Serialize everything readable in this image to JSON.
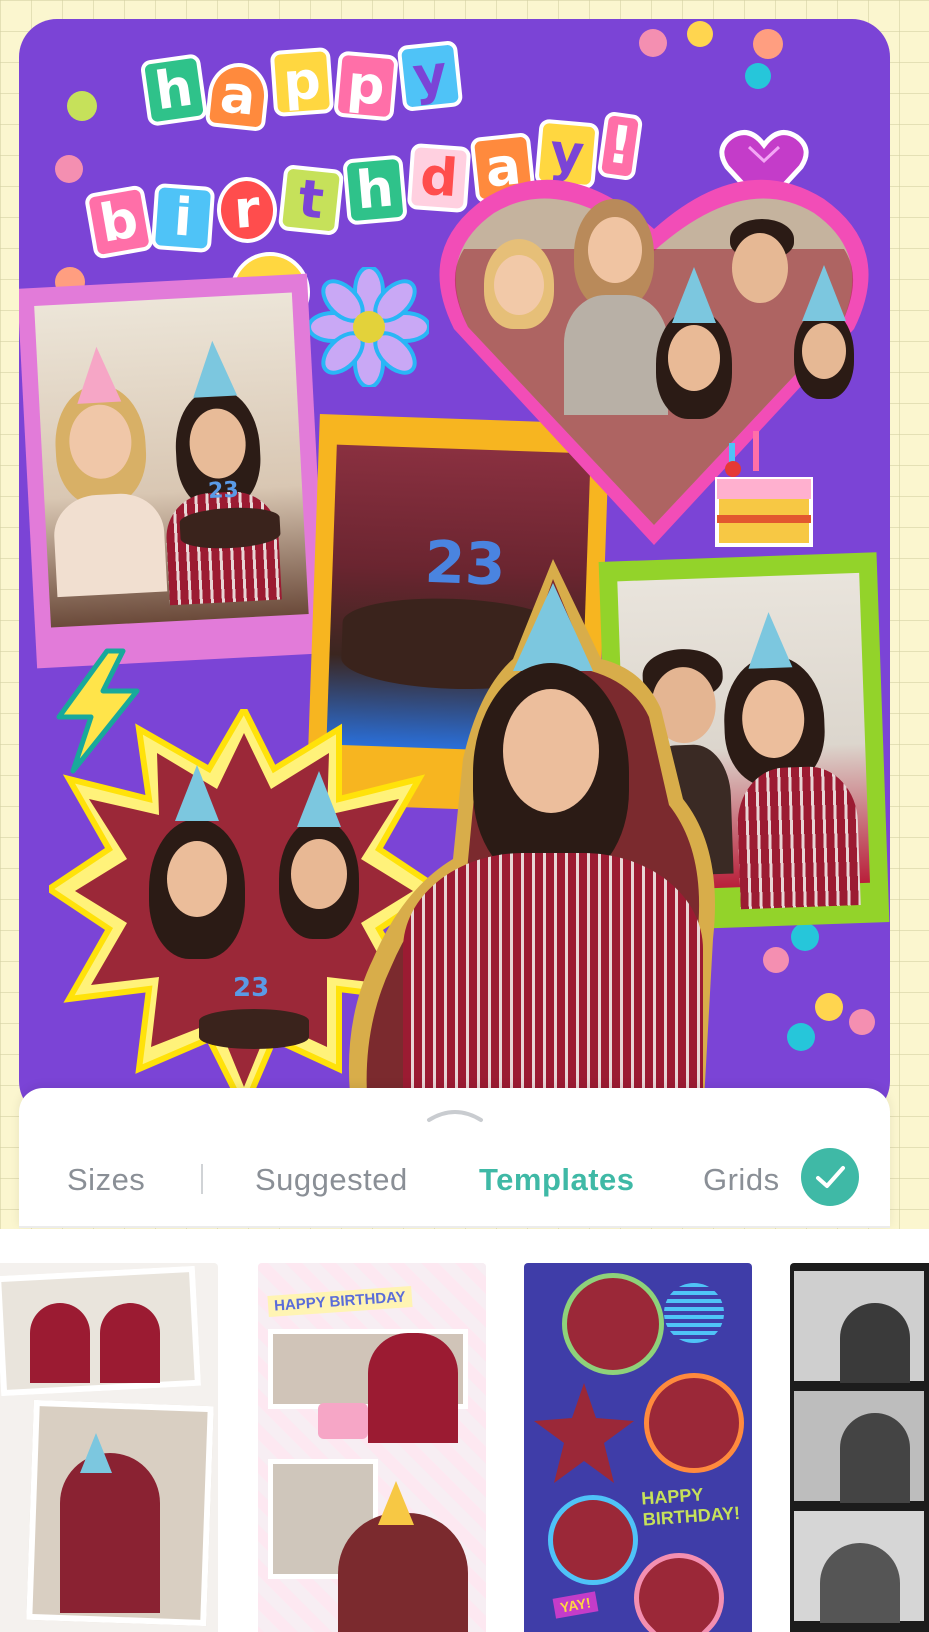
{
  "canvas": {
    "title_line1": [
      "h",
      "a",
      "p",
      "p",
      "y"
    ],
    "title_line2": [
      "b",
      "i",
      "r",
      "t",
      "h",
      "d",
      "a",
      "y",
      "!"
    ],
    "photo_numbers": [
      "23",
      "23",
      "23"
    ]
  },
  "tabs": [
    {
      "label": "Sizes",
      "active": false
    },
    {
      "label": "Suggested",
      "active": false
    },
    {
      "label": "Templates",
      "active": true
    },
    {
      "label": "Grids",
      "active": false
    }
  ],
  "templates": [
    {
      "banner": ""
    },
    {
      "banner": "HAPPY BIRTHDAY"
    },
    {
      "banner": "HAPPY BIRTHDAY!",
      "tag": "YAY!"
    },
    {
      "banner": ""
    }
  ],
  "colors": {
    "canvas_bg": "#7b44d6",
    "accent": "#3fb9a6",
    "tab_inactive": "#8a8f96",
    "page_bg": "#fbf6cf"
  },
  "icons": [
    "chevron-up-icon",
    "checkmark-icon",
    "smiley-sticker",
    "flower-sticker",
    "heart-gem-sticker",
    "lightning-sticker",
    "cake-slice-sticker"
  ]
}
